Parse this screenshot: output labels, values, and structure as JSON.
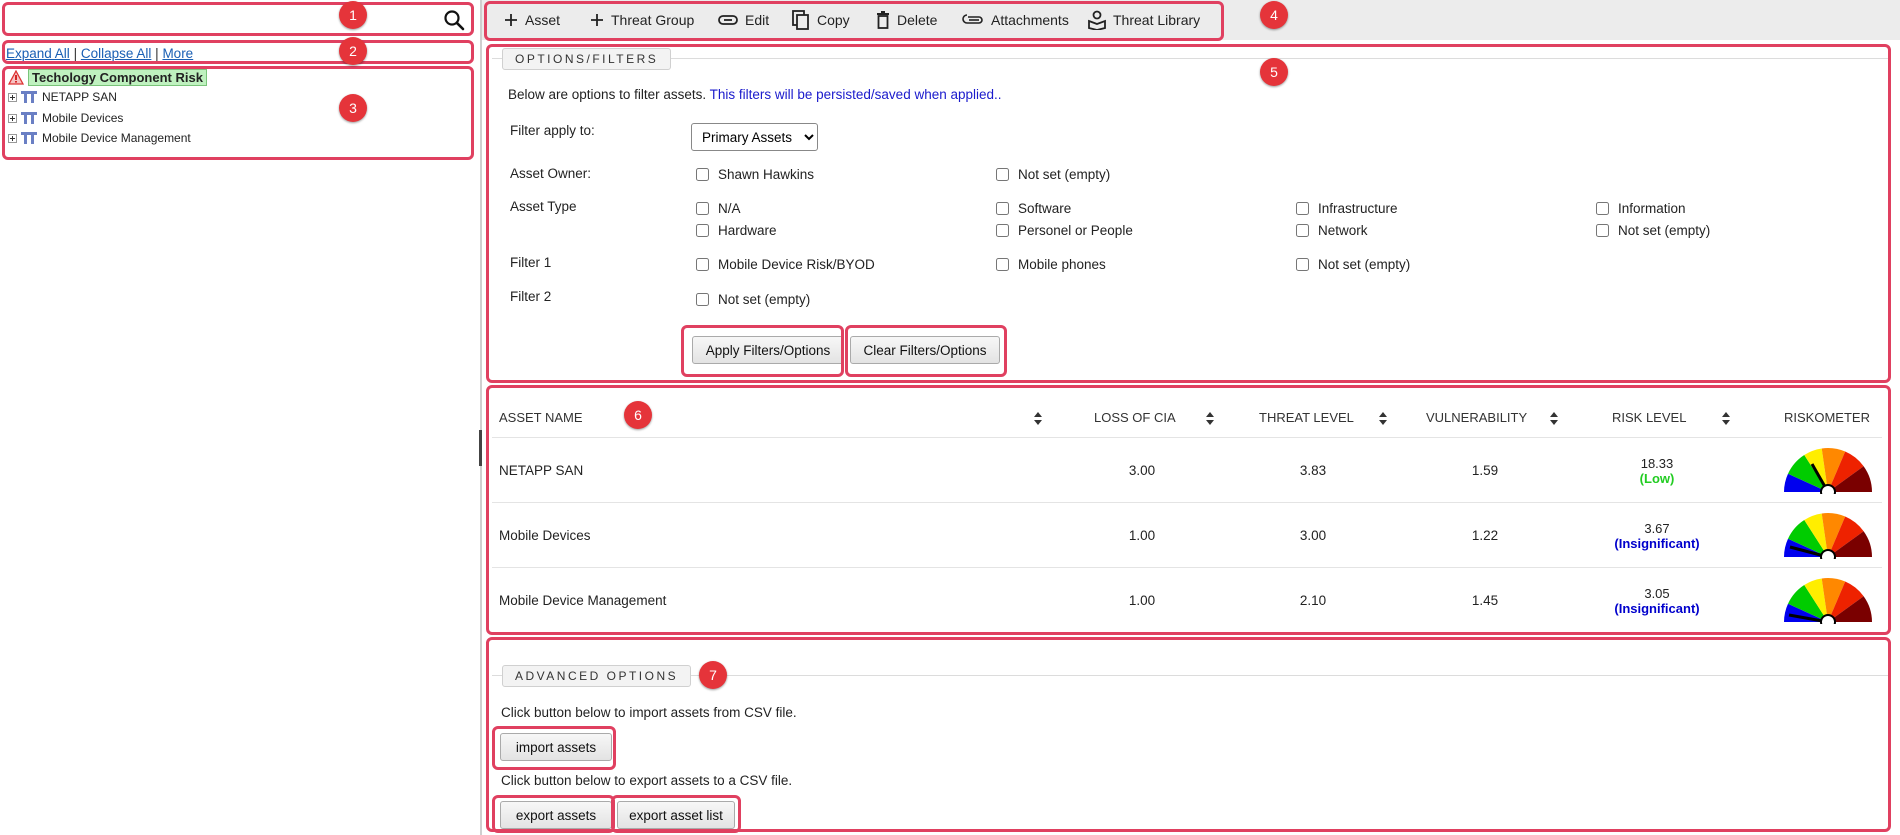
{
  "search": {
    "value": "",
    "placeholder": ""
  },
  "tree_links": {
    "expand_all": "Expand All",
    "collapse_all": "Collapse All",
    "more": "More",
    "separator": "|"
  },
  "tree": {
    "root": "Techology Component Risk",
    "children": [
      "NETAPP SAN",
      "Mobile Devices",
      "Mobile Device Management"
    ]
  },
  "toolbar": {
    "asset": "Asset",
    "threat_group": "Threat Group",
    "edit": "Edit",
    "copy": "Copy",
    "delete": "Delete",
    "attachments": "Attachments",
    "threat_library": "Threat Library"
  },
  "filters": {
    "legend": "OPTIONS/FILTERS",
    "intro": "Below are options to filter assets.",
    "intro_note": "This filters will be persisted/saved when applied..",
    "apply_to_label": "Filter apply to:",
    "apply_to_value": "Primary Assets",
    "asset_owner_label": "Asset Owner:",
    "asset_owner_options": [
      "Shawn Hawkins",
      "Not set (empty)"
    ],
    "asset_type_label": "Asset Type",
    "asset_type_options": [
      "N/A",
      "Software",
      "Infrastructure",
      "Information",
      "Hardware",
      "Personel or People",
      "Network",
      "Not set (empty)"
    ],
    "filter1_label": "Filter 1",
    "filter1_options": [
      "Mobile Device Risk/BYOD",
      "Mobile phones",
      "Not set (empty)"
    ],
    "filter2_label": "Filter 2",
    "filter2_options": [
      "Not set (empty)"
    ],
    "apply_button": "Apply Filters/Options",
    "clear_button": "Clear Filters/Options"
  },
  "table": {
    "headers": [
      "ASSET NAME",
      "LOSS OF CIA",
      "THREAT LEVEL",
      "VULNERABILITY",
      "RISK LEVEL",
      "RISKOMETER"
    ],
    "rows": [
      {
        "name": "NETAPP SAN",
        "loss": "3.00",
        "threat": "3.83",
        "vuln": "1.59",
        "risk": "18.33",
        "level": "(Low)"
      },
      {
        "name": "Mobile Devices",
        "loss": "1.00",
        "threat": "3.00",
        "vuln": "1.22",
        "risk": "3.67",
        "level": "(Insignificant)"
      },
      {
        "name": "Mobile Device Management",
        "loss": "1.00",
        "threat": "2.10",
        "vuln": "1.45",
        "risk": "3.05",
        "level": "(Insignificant)"
      }
    ]
  },
  "advanced": {
    "legend": "ADVANCED OPTIONS",
    "import_text": "Click button below to import assets from CSV file.",
    "import_button": "import assets",
    "export_text": "Click button below to export assets to a CSV file.",
    "export_button": "export assets",
    "export_list_button": "export asset list"
  },
  "badges": [
    "1",
    "2",
    "3",
    "4",
    "5",
    "6",
    "7"
  ],
  "colors": {
    "highlight_red": "#e04060",
    "badge_red": "#e5343a",
    "low_green": "#22cc22",
    "insignificant_blue": "#0000cc",
    "link_blue": "#1a5fb4",
    "note_blue": "#1a1acc",
    "gauge": [
      "#0000ee",
      "#00cc00",
      "#ffee00",
      "#ff8800",
      "#ee2200",
      "#7a0000"
    ]
  }
}
